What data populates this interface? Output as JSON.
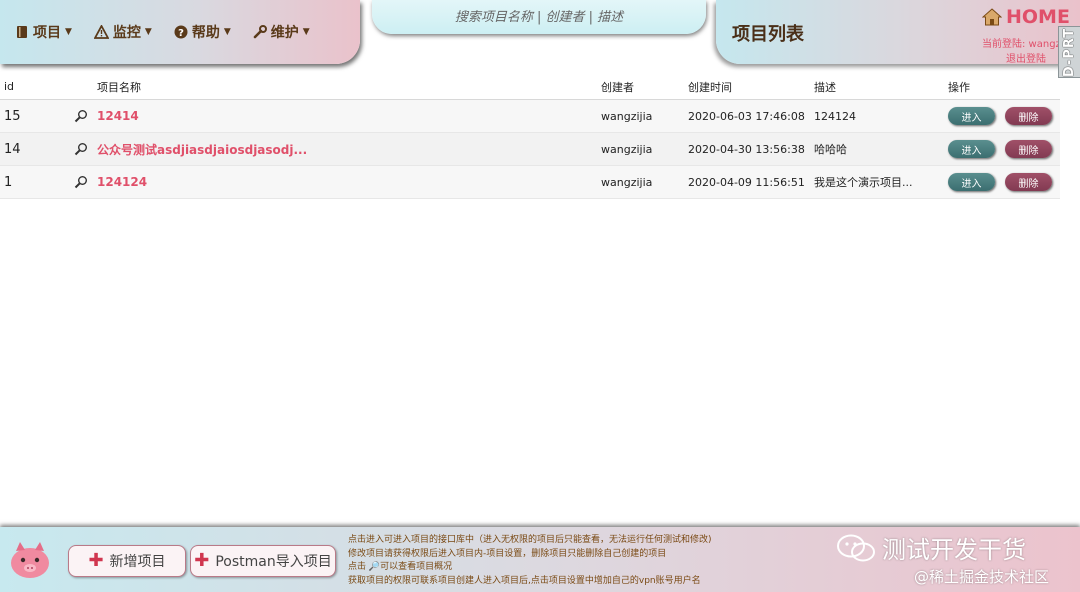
{
  "menu": {
    "items": [
      {
        "label": "项目",
        "icon": "book-icon"
      },
      {
        "label": "监控",
        "icon": "warning-icon"
      },
      {
        "label": "帮助",
        "icon": "question-icon"
      },
      {
        "label": "维护",
        "icon": "wrench-icon"
      }
    ]
  },
  "search": {
    "placeholder": "搜索项目名称 | 创建者 | 描述",
    "value": ""
  },
  "header": {
    "title": "项目列表",
    "home_label": "HOME",
    "login_text": "当前登陆: wangzijia",
    "logout_label": "退出登陆",
    "dprt_label": "D-PRT"
  },
  "table": {
    "headers": {
      "id": "id",
      "name": "项目名称",
      "creator": "创建者",
      "created": "创建时间",
      "desc": "描述",
      "ops": "操作"
    },
    "rows": [
      {
        "id": "15",
        "name": "12414",
        "creator": "wangzijia",
        "created": "2020-06-03 17:46:08",
        "desc": "124124",
        "enter": "进入",
        "delete": "删除"
      },
      {
        "id": "14",
        "name": "公众号测试asdjiasdjaiosdjasodj...",
        "creator": "wangzijia",
        "created": "2020-04-30 13:56:38",
        "desc": "哈哈哈",
        "enter": "进入",
        "delete": "删除"
      },
      {
        "id": "1",
        "name": "124124",
        "creator": "wangzijia",
        "created": "2020-04-09 11:56:51",
        "desc": "我是这个演示项目...",
        "enter": "进入",
        "delete": "删除"
      }
    ]
  },
  "footer": {
    "new_project_label": "新增项目",
    "postman_import_label": "Postman导入项目",
    "notes": [
      "点击进入可进入项目的接口库中（进入无权限的项目后只能查看，无法运行任何测试和修改)",
      "修改项目请获得权限后进入项目内-项目设置，删除项目只能删除自己创建的项目",
      "点击 🔎可以查看项目概况",
      "获取项目的权限可联系项目创建人进入项目后,点击项目设置中增加自己的vpn账号用户名"
    ],
    "watermark_main": "测试开发干货",
    "watermark_sub": "@稀土掘金技术社区"
  },
  "colors": {
    "accent": "#e0506a",
    "enter_button": "#3b6e70",
    "delete_button": "#823a52"
  }
}
